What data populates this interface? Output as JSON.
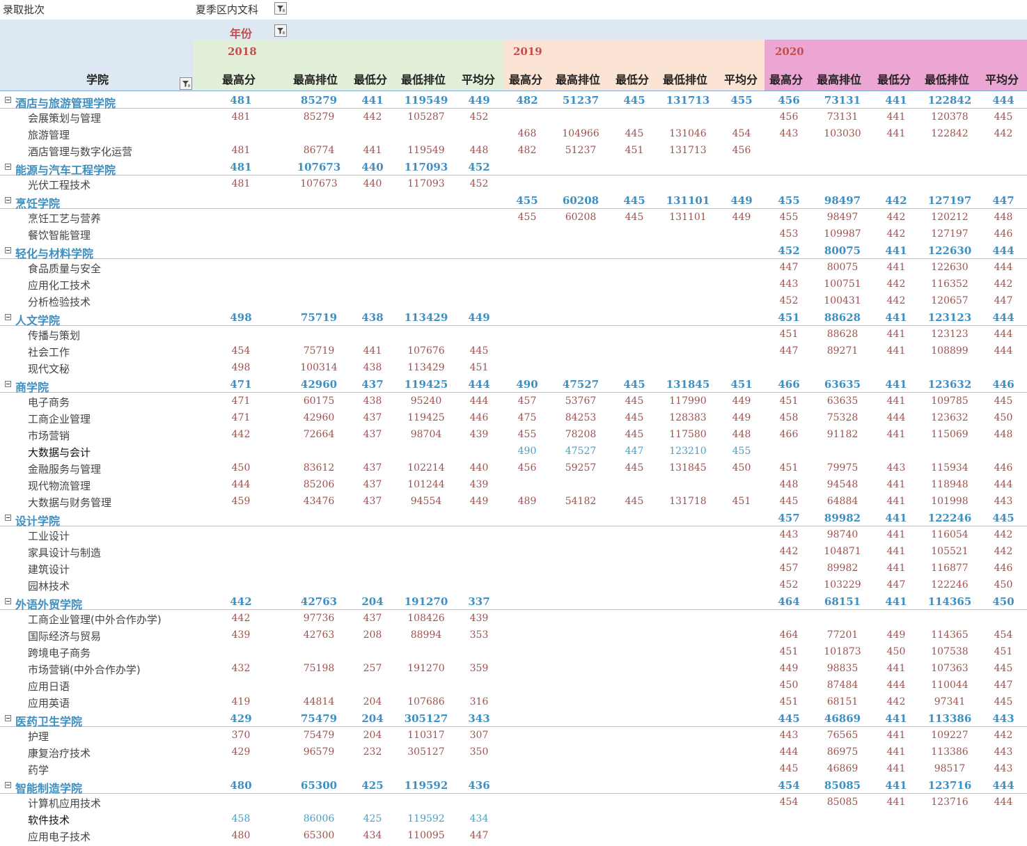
{
  "filter": {
    "label": "录取批次",
    "value": "夏季区内文科"
  },
  "header": {
    "year_field": "年份",
    "row_field": "学院"
  },
  "years": [
    "2018",
    "2019",
    "2020"
  ],
  "metrics": [
    "最高分",
    "最高排位",
    "最低分",
    "最低排位",
    "平均分"
  ],
  "rows": [
    {
      "type": "group",
      "name": "酒店与旅游管理学院",
      "v": [
        "481",
        "85279",
        "441",
        "119549",
        "449",
        "482",
        "51237",
        "445",
        "131713",
        "455",
        "456",
        "73131",
        "441",
        "122842",
        "444"
      ]
    },
    {
      "type": "item",
      "name": "会展策划与管理",
      "v": [
        "481",
        "85279",
        "442",
        "105287",
        "452",
        "",
        "",
        "",
        "",
        "",
        "456",
        "73131",
        "441",
        "120378",
        "445"
      ]
    },
    {
      "type": "item",
      "name": "旅游管理",
      "v": [
        "",
        "",
        "",
        "",
        "",
        "468",
        "104966",
        "445",
        "131046",
        "454",
        "443",
        "103030",
        "441",
        "122842",
        "442"
      ]
    },
    {
      "type": "item",
      "name": "酒店管理与数字化运营",
      "v": [
        "481",
        "86774",
        "441",
        "119549",
        "448",
        "482",
        "51237",
        "451",
        "131713",
        "456",
        "",
        "",
        "",
        "",
        ""
      ]
    },
    {
      "type": "group",
      "name": "能源与汽车工程学院",
      "v": [
        "481",
        "107673",
        "440",
        "117093",
        "452",
        "",
        "",
        "",
        "",
        "",
        "",
        "",
        "",
        "",
        ""
      ]
    },
    {
      "type": "item",
      "name": "光伏工程技术",
      "v": [
        "481",
        "107673",
        "440",
        "117093",
        "452",
        "",
        "",
        "",
        "",
        "",
        "",
        "",
        "",
        "",
        ""
      ]
    },
    {
      "type": "group",
      "name": "烹饪学院",
      "v": [
        "",
        "",
        "",
        "",
        "",
        "455",
        "60208",
        "445",
        "131101",
        "449",
        "455",
        "98497",
        "442",
        "127197",
        "447"
      ]
    },
    {
      "type": "item",
      "name": "烹饪工艺与营养",
      "v": [
        "",
        "",
        "",
        "",
        "",
        "455",
        "60208",
        "445",
        "131101",
        "449",
        "455",
        "98497",
        "442",
        "120212",
        "448"
      ]
    },
    {
      "type": "item",
      "name": "餐饮智能管理",
      "v": [
        "",
        "",
        "",
        "",
        "",
        "",
        "",
        "",
        "",
        "",
        "453",
        "109987",
        "442",
        "127197",
        "446"
      ]
    },
    {
      "type": "group",
      "name": "轻化与材料学院",
      "v": [
        "",
        "",
        "",
        "",
        "",
        "",
        "",
        "",
        "",
        "",
        "452",
        "80075",
        "441",
        "122630",
        "444"
      ]
    },
    {
      "type": "item",
      "name": "食品质量与安全",
      "v": [
        "",
        "",
        "",
        "",
        "",
        "",
        "",
        "",
        "",
        "",
        "447",
        "80075",
        "441",
        "122630",
        "444"
      ]
    },
    {
      "type": "item",
      "name": "应用化工技术",
      "v": [
        "",
        "",
        "",
        "",
        "",
        "",
        "",
        "",
        "",
        "",
        "443",
        "100751",
        "442",
        "116352",
        "442"
      ]
    },
    {
      "type": "item",
      "name": "分析检验技术",
      "v": [
        "",
        "",
        "",
        "",
        "",
        "",
        "",
        "",
        "",
        "",
        "452",
        "100431",
        "442",
        "120657",
        "447"
      ]
    },
    {
      "type": "group",
      "name": "人文学院",
      "v": [
        "498",
        "75719",
        "438",
        "113429",
        "449",
        "",
        "",
        "",
        "",
        "",
        "451",
        "88628",
        "441",
        "123123",
        "444"
      ]
    },
    {
      "type": "item",
      "name": "传播与策划",
      "v": [
        "",
        "",
        "",
        "",
        "",
        "",
        "",
        "",
        "",
        "",
        "451",
        "88628",
        "441",
        "123123",
        "444"
      ]
    },
    {
      "type": "item",
      "name": "社会工作",
      "v": [
        "454",
        "75719",
        "441",
        "107676",
        "445",
        "",
        "",
        "",
        "",
        "",
        "447",
        "89271",
        "441",
        "108899",
        "444"
      ]
    },
    {
      "type": "item",
      "name": "现代文秘",
      "v": [
        "498",
        "100314",
        "438",
        "113429",
        "451",
        "",
        "",
        "",
        "",
        "",
        "",
        "",
        "",
        "",
        ""
      ]
    },
    {
      "type": "group",
      "name": "商学院",
      "v": [
        "471",
        "42960",
        "437",
        "119425",
        "444",
        "490",
        "47527",
        "445",
        "131845",
        "451",
        "466",
        "63635",
        "441",
        "123632",
        "446"
      ]
    },
    {
      "type": "item",
      "name": "电子商务",
      "v": [
        "471",
        "60175",
        "438",
        "95240",
        "444",
        "457",
        "53767",
        "445",
        "117990",
        "449",
        "451",
        "63635",
        "441",
        "109785",
        "445"
      ]
    },
    {
      "type": "item",
      "name": "工商企业管理",
      "v": [
        "471",
        "42960",
        "437",
        "119425",
        "446",
        "475",
        "84253",
        "445",
        "128383",
        "449",
        "458",
        "75328",
        "444",
        "123632",
        "450"
      ]
    },
    {
      "type": "item",
      "name": "市场营销",
      "v": [
        "442",
        "72664",
        "437",
        "98704",
        "439",
        "455",
        "78208",
        "445",
        "117580",
        "448",
        "466",
        "91182",
        "441",
        "115069",
        "448"
      ]
    },
    {
      "type": "item",
      "name": "大数据与会计",
      "style": "blue",
      "v": [
        "",
        "",
        "",
        "",
        "",
        "490",
        "47527",
        "447",
        "123210",
        "455",
        "",
        "",
        "",
        "",
        ""
      ]
    },
    {
      "type": "item",
      "name": "金融服务与管理",
      "v": [
        "450",
        "83612",
        "437",
        "102214",
        "440",
        "456",
        "59257",
        "445",
        "131845",
        "450",
        "451",
        "79975",
        "443",
        "115934",
        "446"
      ]
    },
    {
      "type": "item",
      "name": "现代物流管理",
      "v": [
        "444",
        "85206",
        "437",
        "101244",
        "439",
        "",
        "",
        "",
        "",
        "",
        "448",
        "94548",
        "441",
        "118948",
        "444"
      ]
    },
    {
      "type": "item",
      "name": "大数据与财务管理",
      "v": [
        "459",
        "43476",
        "437",
        "94554",
        "449",
        "489",
        "54182",
        "445",
        "131718",
        "451",
        "445",
        "64884",
        "441",
        "101998",
        "443"
      ]
    },
    {
      "type": "group",
      "name": "设计学院",
      "v": [
        "",
        "",
        "",
        "",
        "",
        "",
        "",
        "",
        "",
        "",
        "457",
        "89982",
        "441",
        "122246",
        "445"
      ]
    },
    {
      "type": "item",
      "name": "工业设计",
      "v": [
        "",
        "",
        "",
        "",
        "",
        "",
        "",
        "",
        "",
        "",
        "443",
        "98740",
        "441",
        "116054",
        "442"
      ]
    },
    {
      "type": "item",
      "name": "家具设计与制造",
      "v": [
        "",
        "",
        "",
        "",
        "",
        "",
        "",
        "",
        "",
        "",
        "442",
        "104871",
        "441",
        "105521",
        "442"
      ]
    },
    {
      "type": "item",
      "name": "建筑设计",
      "v": [
        "",
        "",
        "",
        "",
        "",
        "",
        "",
        "",
        "",
        "",
        "457",
        "89982",
        "441",
        "116877",
        "446"
      ]
    },
    {
      "type": "item",
      "name": "园林技术",
      "v": [
        "",
        "",
        "",
        "",
        "",
        "",
        "",
        "",
        "",
        "",
        "452",
        "103229",
        "447",
        "122246",
        "450"
      ]
    },
    {
      "type": "group",
      "name": "外语外贸学院",
      "v": [
        "442",
        "42763",
        "204",
        "191270",
        "337",
        "",
        "",
        "",
        "",
        "",
        "464",
        "68151",
        "441",
        "114365",
        "450"
      ]
    },
    {
      "type": "item",
      "name": "工商企业管理(中外合作办学)",
      "v": [
        "442",
        "97736",
        "437",
        "108426",
        "439",
        "",
        "",
        "",
        "",
        "",
        "",
        "",
        "",
        "",
        ""
      ]
    },
    {
      "type": "item",
      "name": "国际经济与贸易",
      "v": [
        "439",
        "42763",
        "208",
        "88994",
        "353",
        "",
        "",
        "",
        "",
        "",
        "464",
        "77201",
        "449",
        "114365",
        "454"
      ]
    },
    {
      "type": "item",
      "name": "跨境电子商务",
      "v": [
        "",
        "",
        "",
        "",
        "",
        "",
        "",
        "",
        "",
        "",
        "451",
        "101873",
        "450",
        "107538",
        "451"
      ]
    },
    {
      "type": "item",
      "name": "市场营销(中外合作办学)",
      "v": [
        "432",
        "75198",
        "257",
        "191270",
        "359",
        "",
        "",
        "",
        "",
        "",
        "449",
        "98835",
        "441",
        "107363",
        "445"
      ]
    },
    {
      "type": "item",
      "name": "应用日语",
      "v": [
        "",
        "",
        "",
        "",
        "",
        "",
        "",
        "",
        "",
        "",
        "450",
        "87484",
        "444",
        "110044",
        "447"
      ]
    },
    {
      "type": "item",
      "name": "应用英语",
      "v": [
        "419",
        "44814",
        "204",
        "107686",
        "316",
        "",
        "",
        "",
        "",
        "",
        "451",
        "68151",
        "442",
        "97341",
        "445"
      ]
    },
    {
      "type": "group",
      "name": "医药卫生学院",
      "v": [
        "429",
        "75479",
        "204",
        "305127",
        "343",
        "",
        "",
        "",
        "",
        "",
        "445",
        "46869",
        "441",
        "113386",
        "443"
      ]
    },
    {
      "type": "item",
      "name": "护理",
      "v": [
        "370",
        "75479",
        "204",
        "110317",
        "307",
        "",
        "",
        "",
        "",
        "",
        "443",
        "76565",
        "441",
        "109227",
        "442"
      ]
    },
    {
      "type": "item",
      "name": "康复治疗技术",
      "v": [
        "429",
        "96579",
        "232",
        "305127",
        "350",
        "",
        "",
        "",
        "",
        "",
        "444",
        "86975",
        "441",
        "113386",
        "443"
      ]
    },
    {
      "type": "item",
      "name": "药学",
      "v": [
        "",
        "",
        "",
        "",
        "",
        "",
        "",
        "",
        "",
        "",
        "445",
        "46869",
        "441",
        "98517",
        "443"
      ]
    },
    {
      "type": "group",
      "name": "智能制造学院",
      "v": [
        "480",
        "65300",
        "425",
        "119592",
        "436",
        "",
        "",
        "",
        "",
        "",
        "454",
        "85085",
        "441",
        "123716",
        "444"
      ]
    },
    {
      "type": "item",
      "name": "计算机应用技术",
      "v": [
        "",
        "",
        "",
        "",
        "",
        "",
        "",
        "",
        "",
        "",
        "454",
        "85085",
        "441",
        "123716",
        "444"
      ]
    },
    {
      "type": "item",
      "name": "软件技术",
      "style": "blue",
      "v": [
        "458",
        "86006",
        "425",
        "119592",
        "434",
        "",
        "",
        "",
        "",
        "",
        "",
        "",
        "",
        "",
        ""
      ]
    },
    {
      "type": "item",
      "name": "应用电子技术",
      "v": [
        "480",
        "65300",
        "434",
        "110095",
        "447",
        "",
        "",
        "",
        "",
        "",
        "",
        "",
        "",
        "",
        ""
      ]
    }
  ]
}
